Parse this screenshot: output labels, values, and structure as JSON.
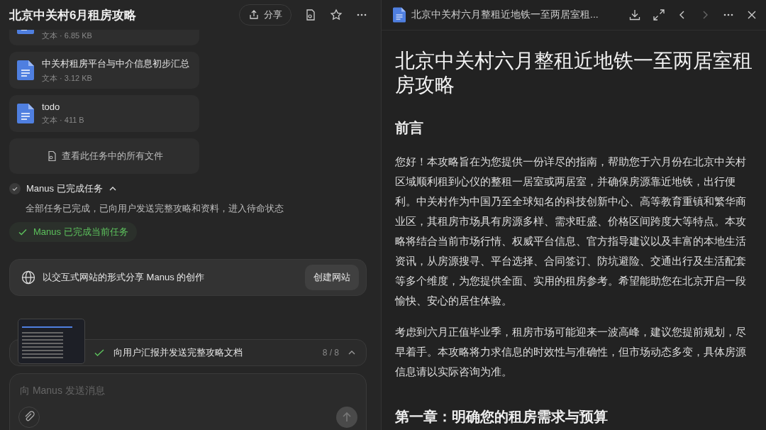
{
  "task": {
    "title": "北京中关村6月租房攻略",
    "share_label": "分享"
  },
  "files": [
    {
      "meta": "文本 · 6.85 KB"
    },
    {
      "name": "中关村租房平台与中介信息初步汇总",
      "meta": "文本 · 3.12 KB"
    },
    {
      "name": "todo",
      "meta": "文本 · 411 B"
    }
  ],
  "view_all_files": "查看此任务中的所有文件",
  "status": {
    "title": "Manus 已完成任务",
    "expanded": true,
    "detail": "全部任务已完成，已向用户发送完整攻略和资料，进入待命状态",
    "badge": "Manus 已完成当前任务"
  },
  "share_site": {
    "text": "以交互式网站的形式分享 Manus 的创作",
    "button": "创建网站"
  },
  "progress": {
    "step": "向用户汇报并发送完整攻略文档",
    "count": "8 / 8",
    "expanded": false
  },
  "composer": {
    "placeholder": "向 Manus 发送消息"
  },
  "viewer": {
    "title": "北京中关村六月整租近地铁一至两居室租...",
    "doc": [
      {
        "kind": "h1",
        "text": "北京中关村六月整租近地铁一至两居室租房攻略"
      },
      {
        "kind": "h2",
        "text": "前言"
      },
      {
        "kind": "p",
        "text": "您好！本攻略旨在为您提供一份详尽的指南，帮助您于六月份在北京中关村区域顺利租到心仪的整租一居室或两居室，并确保房源靠近地铁，出行便利。中关村作为中国乃至全球知名的科技创新中心、高等教育重镇和繁华商业区，其租房市场具有房源多样、需求旺盛、价格区间跨度大等特点。本攻略将结合当前市场行情、权威平台信息、官方指导建议以及丰富的本地生活资讯，从房源搜寻、平台选择、合同签订、防坑避险、交通出行及生活配套等多个维度，为您提供全面、实用的租房参考。希望能助您在北京开启一段愉快、安心的居住体验。"
      },
      {
        "kind": "p",
        "text": "考虑到六月正值毕业季，租房市场可能迎来一波高峰，建议您提前规划，尽早着手。本攻略将力求信息的时效性与准确性，但市场动态多变，具体房源信息请以实际咨询为准。"
      },
      {
        "kind": "h2",
        "text": "第一章：明确您的租房需求与预算"
      }
    ]
  }
}
